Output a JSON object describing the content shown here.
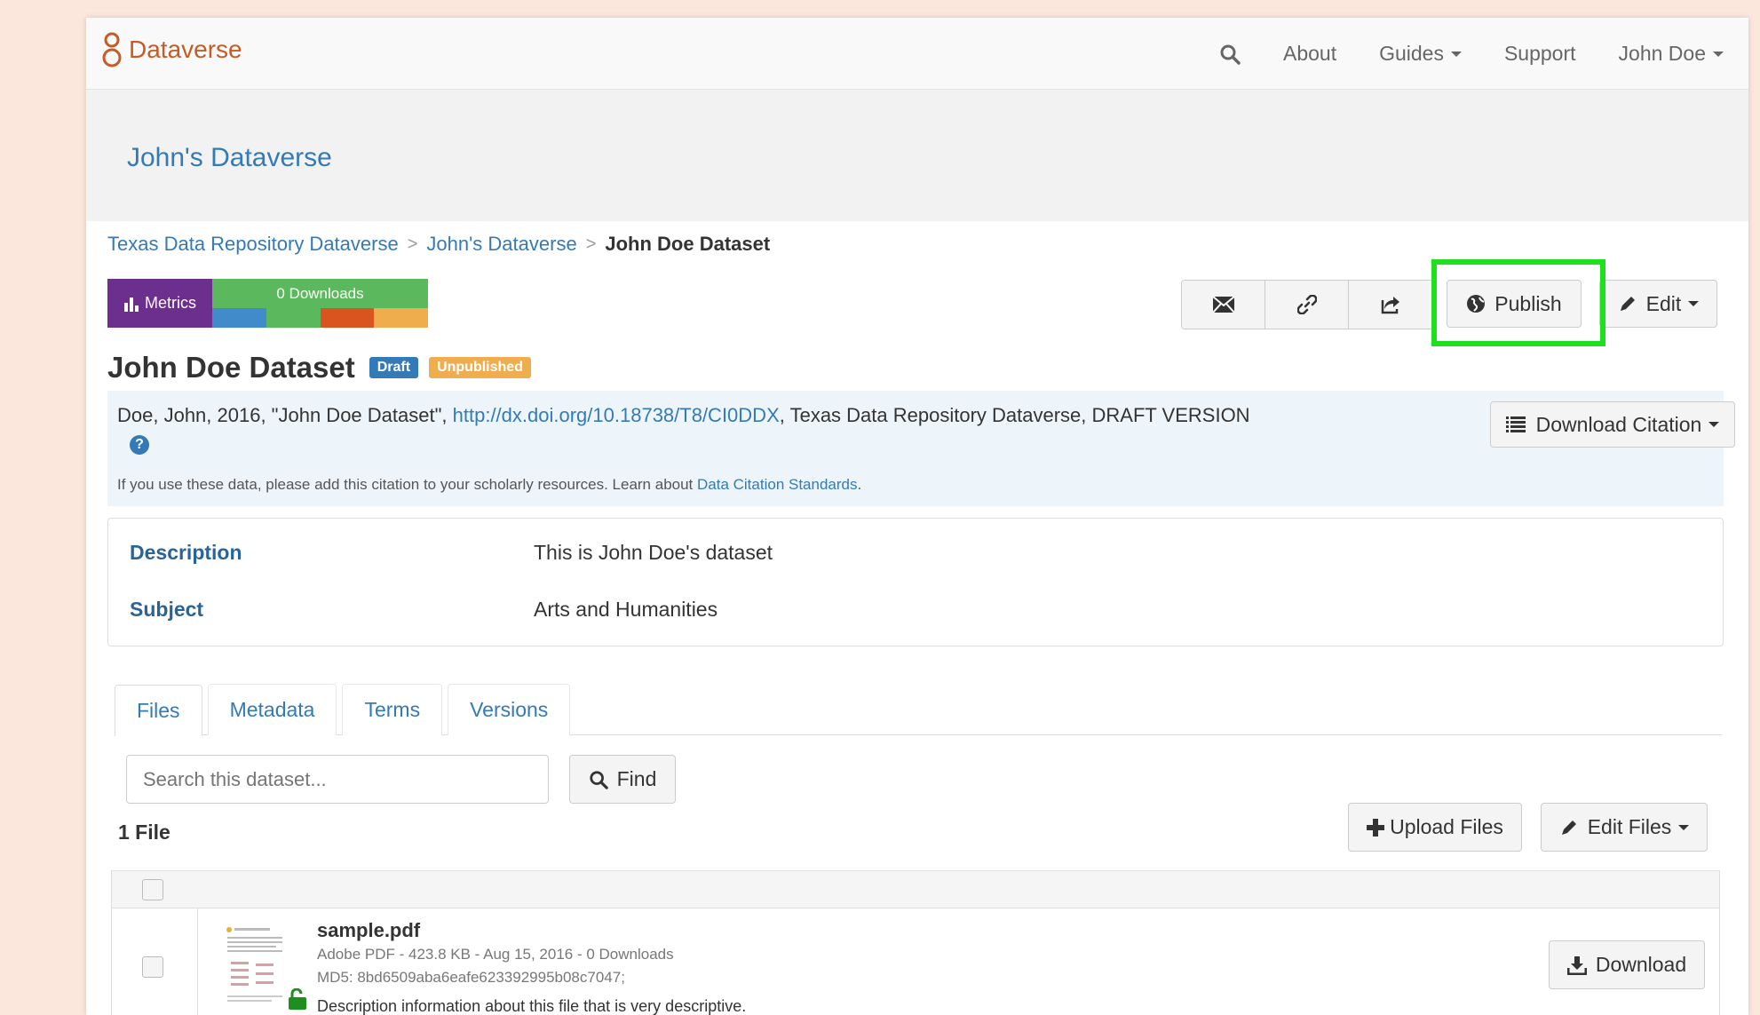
{
  "navbar": {
    "brand": "Dataverse",
    "about": "About",
    "guides": "Guides",
    "support": "Support",
    "user": "John Doe"
  },
  "dataverse_header": {
    "title": "John's Dataverse"
  },
  "breadcrumb": {
    "root": "Texas Data Repository Dataverse",
    "sep1": ">",
    "parent": "John's Dataverse",
    "sep2": ">",
    "current": "John Doe Dataset"
  },
  "metrics": {
    "label": "Metrics",
    "downloads": "0 Downloads",
    "colors": [
      "#428bca",
      "#5cb85c",
      "#d9541e",
      "#f0ad4e"
    ]
  },
  "actions": {
    "publish": "Publish",
    "edit": "Edit"
  },
  "dataset": {
    "title": "John Doe Dataset",
    "badge_draft": "Draft",
    "badge_unpublished": "Unpublished",
    "citation_pre": "Doe, John, 2016, \"John Doe Dataset\", ",
    "citation_link": "http://dx.doi.org/10.18738/T8/CI0DDX",
    "citation_post": ", Texas Data Repository Dataverse, DRAFT VERSION",
    "help": "?",
    "note_pre": "If you use these data, please add this citation to your scholarly resources. Learn about ",
    "note_link": "Data Citation Standards",
    "note_post": ".",
    "download_citation": "Download Citation"
  },
  "metadata": [
    {
      "key": "Description",
      "value": "This is John Doe's dataset"
    },
    {
      "key": "Subject",
      "value": "Arts and Humanities"
    }
  ],
  "tabs": [
    "Files",
    "Metadata",
    "Terms",
    "Versions"
  ],
  "files": {
    "search_placeholder": "Search this dataset...",
    "find": "Find",
    "count": "1 File",
    "upload": "Upload Files",
    "edit_files": "Edit Files",
    "rows": [
      {
        "name": "sample.pdf",
        "meta": "Adobe PDF - 423.8 KB - Aug 15, 2016 - 0 Downloads",
        "md5": "MD5: 8bd6509aba6eafe623392995b08c7047;",
        "description": "Description information about this file that is very descriptive.",
        "download": "Download"
      }
    ]
  },
  "highlight_color": "#1fe01f"
}
